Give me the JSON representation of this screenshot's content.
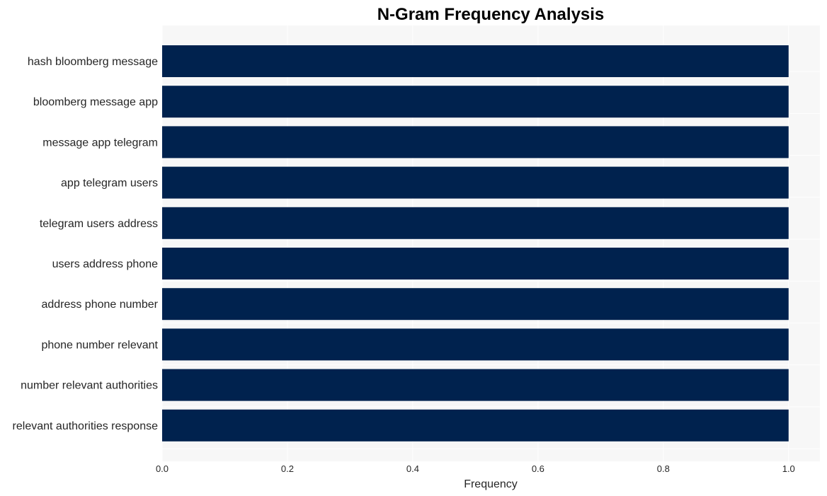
{
  "chart_data": {
    "type": "bar",
    "orientation": "horizontal",
    "title": "N-Gram Frequency Analysis",
    "xlabel": "Frequency",
    "ylabel": "",
    "categories": [
      "hash bloomberg message",
      "bloomberg message app",
      "message app telegram",
      "app telegram users",
      "telegram users address",
      "users address phone",
      "address phone number",
      "phone number relevant",
      "number relevant authorities",
      "relevant authorities response"
    ],
    "values": [
      1,
      1,
      1,
      1,
      1,
      1,
      1,
      1,
      1,
      1
    ],
    "xlim": [
      0,
      1.05
    ],
    "xticks": [
      0.0,
      0.2,
      0.4,
      0.6,
      0.8,
      1.0
    ],
    "xtick_labels": [
      "0.0",
      "0.2",
      "0.4",
      "0.6",
      "0.8",
      "1.0"
    ],
    "grid": true,
    "legend": "none",
    "colors": {
      "bar": "#00224e",
      "plot_background": "#f7f7f7",
      "grid": "#ffffff"
    }
  }
}
